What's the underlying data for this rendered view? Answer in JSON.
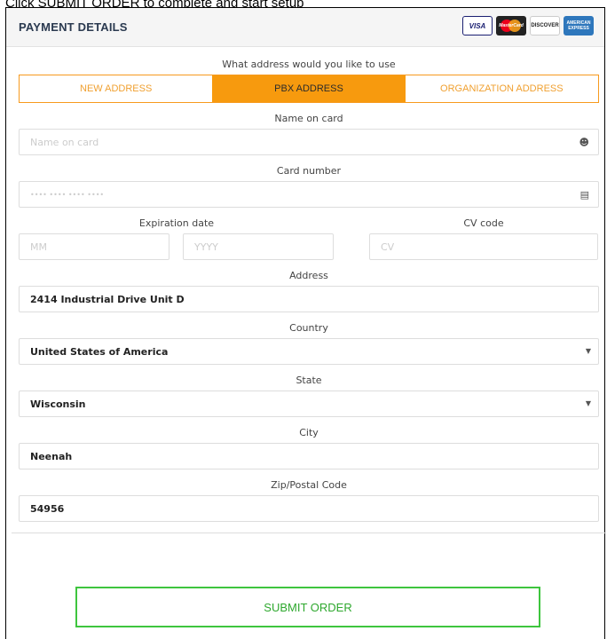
{
  "instruction": "Click SUBMIT ORDER to complete and start setup",
  "header": {
    "title": "PAYMENT DETAILS",
    "cards": [
      "VISA",
      "MasterCard",
      "DISCOVER",
      "AMERICAN EXPRESS"
    ]
  },
  "address_choice": {
    "label": "What address would you like to use",
    "tabs": [
      {
        "label": "NEW ADDRESS",
        "active": false
      },
      {
        "label": "PBX ADDRESS",
        "active": true
      },
      {
        "label": "ORGANIZATION ADDRESS",
        "active": false
      }
    ]
  },
  "name_on_card": {
    "label": "Name on card",
    "placeholder": "Name on card",
    "icon": "user-icon"
  },
  "card_number": {
    "label": "Card number",
    "placeholder": "•••• •••• •••• ••••",
    "icon": "credit-card-icon"
  },
  "expiration": {
    "label": "Expiration date",
    "month_placeholder": "MM",
    "year_placeholder": "YYYY"
  },
  "cv_code": {
    "label": "CV code",
    "placeholder": "CV"
  },
  "address": {
    "label": "Address",
    "value": "2414 Industrial Drive Unit D"
  },
  "country": {
    "label": "Country",
    "value": "United States of America"
  },
  "state": {
    "label": "State",
    "value": "Wisconsin"
  },
  "city": {
    "label": "City",
    "value": "Neenah"
  },
  "zip": {
    "label": "Zip/Postal Code",
    "value": "54956"
  },
  "submit_label": "SUBMIT ORDER",
  "colors": {
    "accent": "#f79a0e",
    "submit": "#3ec53e"
  }
}
